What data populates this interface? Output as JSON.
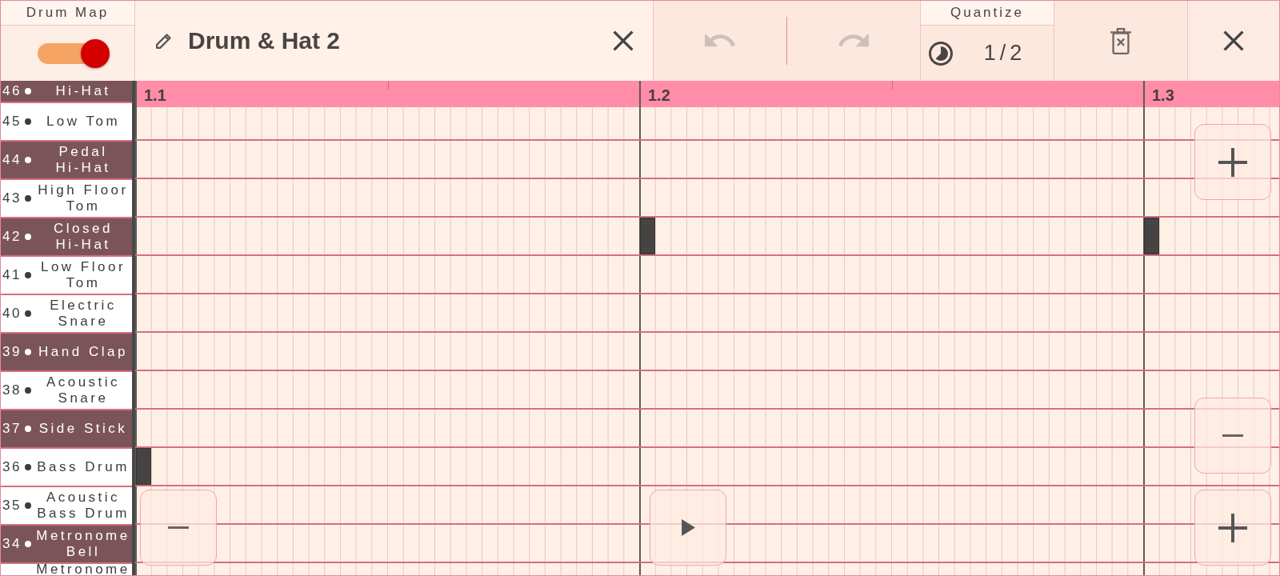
{
  "drum_map": {
    "label": "Drum Map",
    "toggle": {
      "on": true
    }
  },
  "title_bar": {
    "title": "Drum & Hat 2"
  },
  "history": {
    "undo": {
      "disabled": true
    },
    "redo": {
      "disabled": true
    }
  },
  "quantize": {
    "label": "Quantize",
    "value": "1/2"
  },
  "ruler": {
    "markers": [
      "1.1",
      "1.2",
      "1.3"
    ]
  },
  "keys": [
    {
      "number": "46",
      "name": "Hi-Hat",
      "kind": "black"
    },
    {
      "number": "45",
      "name": "Low Tom",
      "kind": "white",
      "hits": [
        false,
        false,
        false
      ]
    },
    {
      "number": "44",
      "name": "Pedal Hi-Hat",
      "kind": "black",
      "hits": [
        false,
        false,
        false
      ]
    },
    {
      "number": "43",
      "name": "High Floor Tom",
      "kind": "white",
      "hits": [
        false,
        false,
        false
      ]
    },
    {
      "number": "42",
      "name": "Closed Hi-Hat",
      "kind": "black",
      "hits": [
        false,
        true,
        true
      ]
    },
    {
      "number": "41",
      "name": "Low Floor Tom",
      "kind": "white",
      "hits": [
        false,
        false,
        false
      ]
    },
    {
      "number": "40",
      "name": "Electric Snare",
      "kind": "white",
      "hits": [
        false,
        false,
        false
      ]
    },
    {
      "number": "39",
      "name": "Hand Clap",
      "kind": "black",
      "hits": [
        false,
        false,
        false
      ]
    },
    {
      "number": "38",
      "name": "Acoustic Snare",
      "kind": "white",
      "hits": [
        false,
        false,
        false
      ]
    },
    {
      "number": "37",
      "name": "Side Stick",
      "kind": "black",
      "hits": [
        false,
        false,
        false
      ]
    },
    {
      "number": "36",
      "name": "Bass Drum",
      "kind": "white",
      "hits": [
        true,
        false,
        false
      ]
    },
    {
      "number": "35",
      "name": "Acoustic Bass Drum",
      "kind": "white",
      "hits": [
        false,
        false,
        false
      ]
    },
    {
      "number": "34",
      "name": "Metronome Bell",
      "kind": "black",
      "hits": [
        false,
        false,
        false
      ]
    },
    {
      "name": "Metronome",
      "kind": "white",
      "hits": [
        false,
        false,
        false
      ]
    }
  ]
}
